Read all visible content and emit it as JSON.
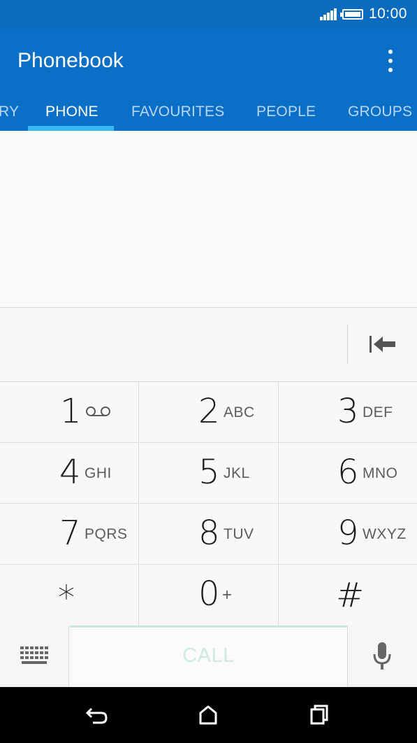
{
  "status": {
    "time": "10:00",
    "icons": [
      "signal-icon",
      "battery-icon"
    ]
  },
  "appbar": {
    "title": "Phonebook",
    "menu_icon": "more-vert-icon"
  },
  "tabs": [
    {
      "label": "RY",
      "active": false
    },
    {
      "label": "PHONE",
      "active": true
    },
    {
      "label": "FAVOURITES",
      "active": false
    },
    {
      "label": "PEOPLE",
      "active": false
    },
    {
      "label": "GROUPS",
      "active": false
    }
  ],
  "keypad": [
    {
      "digit": "1",
      "letters": "",
      "icon": "voicemail-icon"
    },
    {
      "digit": "2",
      "letters": "ABC"
    },
    {
      "digit": "3",
      "letters": "DEF"
    },
    {
      "digit": "4",
      "letters": "GHI"
    },
    {
      "digit": "5",
      "letters": "JKL"
    },
    {
      "digit": "6",
      "letters": "MNO"
    },
    {
      "digit": "7",
      "letters": "PQRS"
    },
    {
      "digit": "8",
      "letters": "TUV"
    },
    {
      "digit": "9",
      "letters": "WXYZ"
    },
    {
      "digit": "*",
      "letters": ""
    },
    {
      "digit": "0",
      "letters": "+"
    },
    {
      "digit": "#",
      "letters": ""
    }
  ],
  "actions": {
    "call_label": "CALL",
    "keyboard_icon": "keyboard-icon",
    "mic_icon": "mic-icon",
    "backspace_icon": "backspace-icon"
  },
  "colors": {
    "appbar": "#0a6fc7",
    "statusbar": "#0a6bbf",
    "tab_indicator": "#38b5f3",
    "call_disabled": "#cde9e2"
  },
  "navbar": {
    "icons": [
      "back-icon",
      "home-icon",
      "recents-icon"
    ]
  }
}
